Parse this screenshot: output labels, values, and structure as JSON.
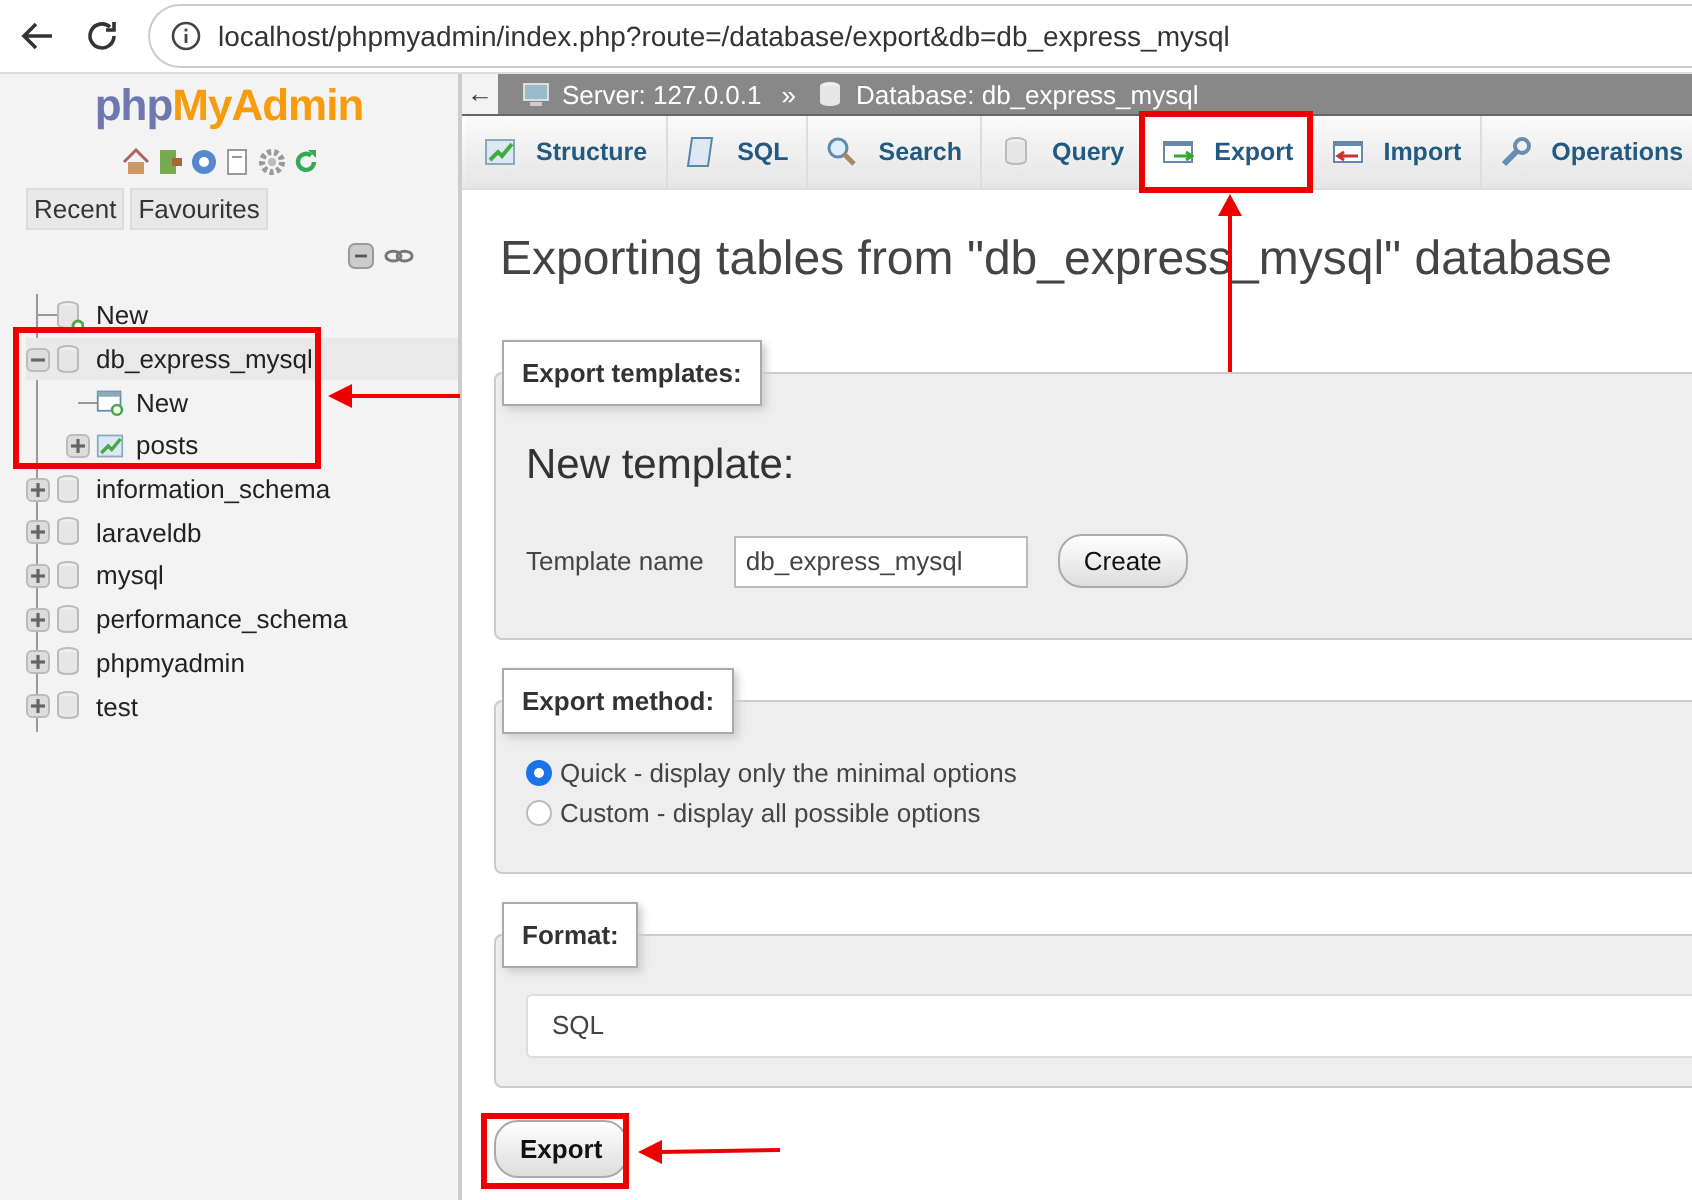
{
  "browser": {
    "url": "localhost/phpmyadmin/index.php?route=/database/export&db=db_express_mysql"
  },
  "sidebar": {
    "logo": [
      "php",
      "MyAdmin"
    ],
    "buttons": [
      "Recent",
      "Favourites"
    ],
    "tree": [
      {
        "label": "New",
        "kind": "new"
      },
      {
        "label": "db_express_mysql",
        "kind": "database",
        "expanded": true,
        "children": [
          {
            "label": "New",
            "kind": "new"
          },
          {
            "label": "posts",
            "kind": "table",
            "expanded": false
          }
        ]
      },
      {
        "label": "information_schema",
        "kind": "database",
        "expanded": false
      },
      {
        "label": "laraveldb",
        "kind": "database",
        "expanded": false
      },
      {
        "label": "mysql",
        "kind": "database",
        "expanded": false
      },
      {
        "label": "performance_schema",
        "kind": "database",
        "expanded": false
      },
      {
        "label": "phpmyadmin",
        "kind": "database",
        "expanded": false
      },
      {
        "label": "test",
        "kind": "database",
        "expanded": false
      }
    ]
  },
  "breadcrumb": {
    "toggle": "←",
    "server": "Server: 127.0.0.1",
    "separator": "»",
    "database": "Database: db_express_mysql"
  },
  "tabs": [
    {
      "label": "Structure",
      "selected": false
    },
    {
      "label": "SQL",
      "selected": false
    },
    {
      "label": "Search",
      "selected": false
    },
    {
      "label": "Query",
      "selected": false
    },
    {
      "label": "Export",
      "selected": true
    },
    {
      "label": "Import",
      "selected": false
    },
    {
      "label": "Operations",
      "selected": false
    }
  ],
  "heading": "Exporting tables from \"db_express_mysql\" database",
  "templates": {
    "legend": "Export templates:",
    "title": "New template:",
    "name_label": "Template name",
    "name_value": "db_express_mysql",
    "create": "Create"
  },
  "method": {
    "legend": "Export method:",
    "options": [
      {
        "label": "Quick - display only the minimal options",
        "selected": true
      },
      {
        "label": "Custom - display all possible options",
        "selected": false
      }
    ]
  },
  "format": {
    "legend": "Format:",
    "value": "SQL"
  },
  "export_button": "Export"
}
